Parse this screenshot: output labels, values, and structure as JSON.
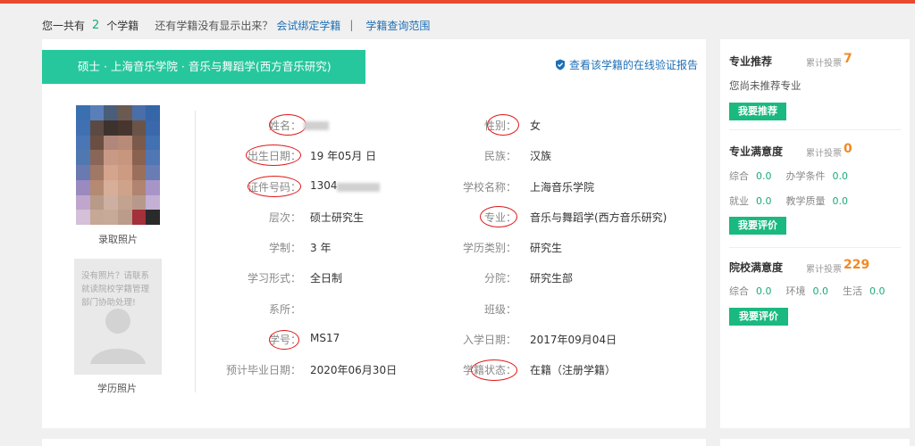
{
  "summary": {
    "prefix": "您一共有",
    "count": "2",
    "suffix": "个学籍",
    "question": "还有学籍没有显示出来？",
    "bind_link": "会试绑定学籍",
    "separator": "|",
    "scope_link": "学籍查询范围"
  },
  "record": {
    "banner": "硕士 · 上海音乐学院 · 音乐与舞蹈学(西方音乐研究)",
    "verify_link": "查看该学籍的在线验证报告",
    "photo1_label": "录取照片",
    "photo2_msg": "没有照片？请联系就读院校学籍管理部门协助处理!",
    "photo2_label": "学历照片",
    "fields_left": [
      {
        "label": "姓名：",
        "value": ""
      },
      {
        "label": "出生日期：",
        "value": "19   年05月  日"
      },
      {
        "label": "证件号码：",
        "value": "1304"
      },
      {
        "label": "层次：",
        "value": "硕士研究生"
      },
      {
        "label": "学制：",
        "value": "3 年"
      },
      {
        "label": "学习形式：",
        "value": "全日制"
      },
      {
        "label": "系所：",
        "value": ""
      },
      {
        "label": "学号：",
        "value": "MS17"
      },
      {
        "label": "预计毕业日期：",
        "value": "2020年06月30日"
      }
    ],
    "fields_right": [
      {
        "label": "性别：",
        "value": "女"
      },
      {
        "label": "民族：",
        "value": "汉族"
      },
      {
        "label": "学校名称：",
        "value": "上海音乐学院"
      },
      {
        "label": "专业：",
        "value": "音乐与舞蹈学(西方音乐研究)"
      },
      {
        "label": "学历类别：",
        "value": "研究生"
      },
      {
        "label": "分院：",
        "value": "研究生部"
      },
      {
        "label": "班级：",
        "value": ""
      },
      {
        "label": "入学日期：",
        "value": "2017年09月04日"
      },
      {
        "label": "学籍状态：",
        "value": "在籍（注册学籍）"
      }
    ]
  },
  "side": {
    "rec": {
      "title": "专业推荐",
      "vote_label": "累计投票",
      "votes": "7",
      "desc": "您尚未推荐专业",
      "btn": "我要推荐"
    },
    "major": {
      "title": "专业满意度",
      "vote_label": "累计投票",
      "votes": "0",
      "rows": [
        {
          "a": "综合",
          "av": "0.0",
          "b": "办学条件",
          "bv": "0.0"
        },
        {
          "a": "就业",
          "av": "0.0",
          "b": "教学质量",
          "bv": "0.0"
        }
      ],
      "btn": "我要评价"
    },
    "school": {
      "title": "院校满意度",
      "vote_label": "累计投票",
      "votes": "229",
      "row": {
        "a": "综合",
        "av": "0.0",
        "b": "环境",
        "bv": "0.0",
        "c": "生活",
        "cv": "0.0"
      },
      "btn": "我要评价"
    }
  },
  "colors": {
    "accent": "#27c79d",
    "brand_red": "#e8492f",
    "link": "#1f6fb5",
    "vote": "#f08a24",
    "circle": "#e01818"
  },
  "icons": {
    "verify": "shield-check-icon"
  }
}
